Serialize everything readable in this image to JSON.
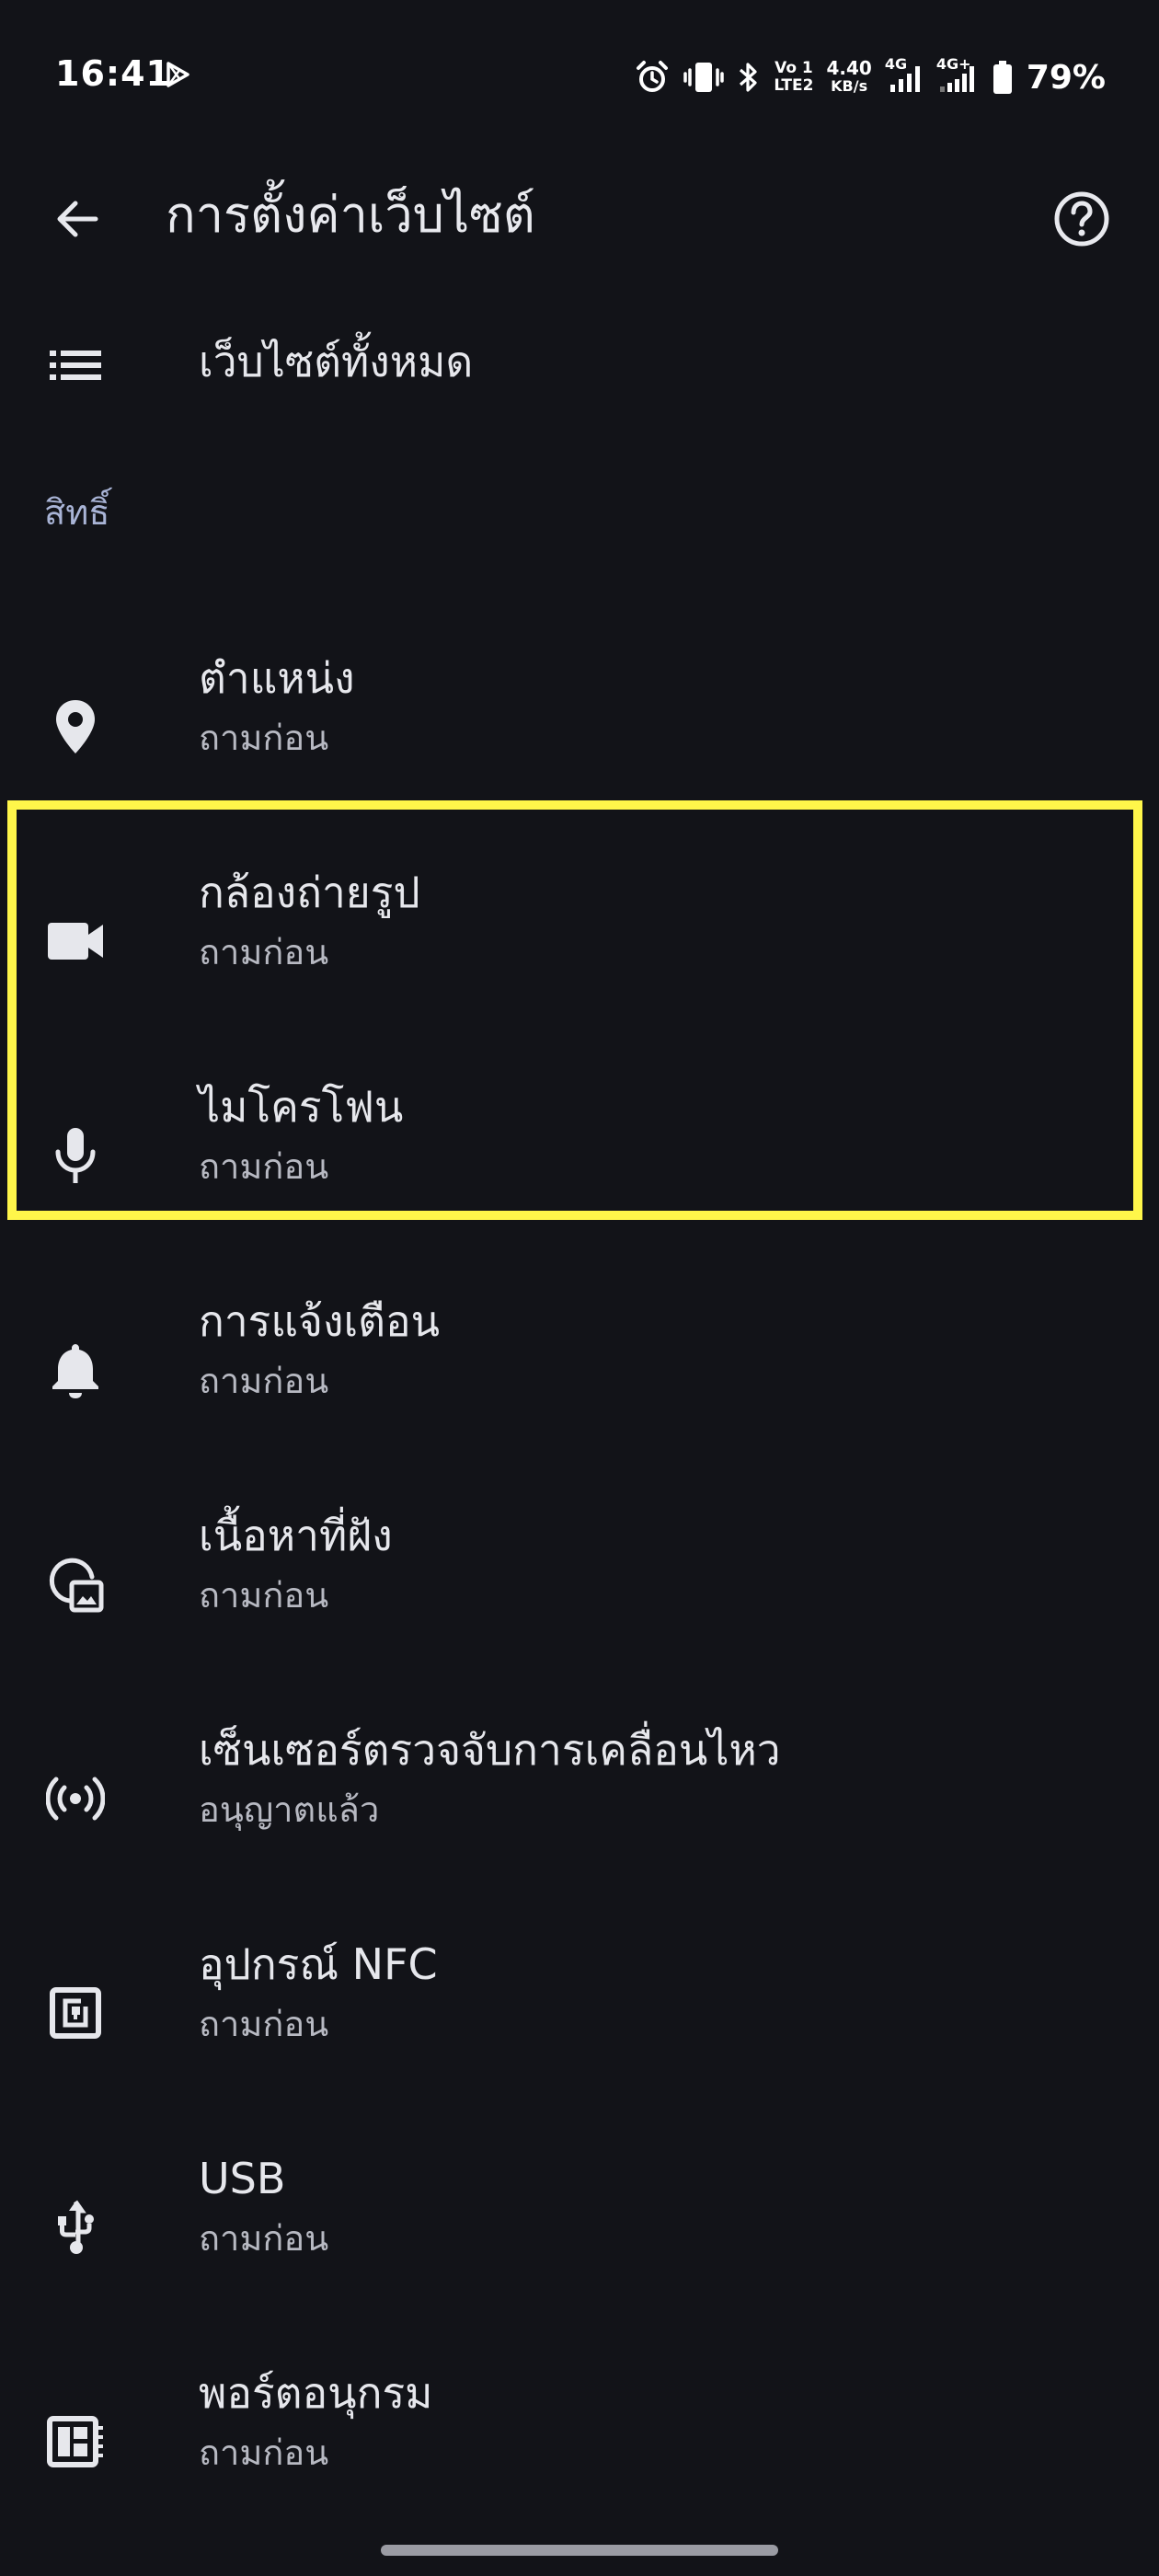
{
  "status_bar": {
    "time": "16:41",
    "volte_line1": "Vo 1",
    "volte_line2": "LTE2",
    "speed_value": "4.40",
    "speed_unit": "KB/s",
    "sim1_label": "4G",
    "sim2_label": "4G+",
    "battery_percent": "79%",
    "icons": [
      "play-store-icon",
      "alarm-icon",
      "vibrate-icon",
      "bluetooth-icon",
      "signal-icon",
      "battery-icon"
    ]
  },
  "app_bar": {
    "title": "การตั้งค่าเว็บไซต์",
    "back_icon": "arrow-back-icon",
    "help_icon": "help-circle-icon"
  },
  "all_sites": {
    "label": "เว็บไซต์ทั้งหมด",
    "icon": "list-icon"
  },
  "permissions": {
    "section_label": "สิทธิ์",
    "items": [
      {
        "title": "ตำแหน่ง",
        "status": "ถามก่อน",
        "icon": "location-pin-icon"
      },
      {
        "title": "กล้องถ่ายรูป",
        "status": "ถามก่อน",
        "icon": "videocam-icon"
      },
      {
        "title": "ไมโครโฟน",
        "status": "ถามก่อน",
        "icon": "microphone-icon"
      },
      {
        "title": "การแจ้งเตือน",
        "status": "ถามก่อน",
        "icon": "bell-icon"
      },
      {
        "title": "เนื้อหาที่ฝัง",
        "status": "ถามก่อน",
        "icon": "embedded-content-icon"
      },
      {
        "title": "เซ็นเซอร์ตรวจจับการเคลื่อนไหว",
        "status": "อนุญาตแล้ว",
        "icon": "motion-sensor-icon"
      },
      {
        "title": "อุปกรณ์ NFC",
        "status": "ถามก่อน",
        "icon": "nfc-icon"
      },
      {
        "title": "USB",
        "status": "ถามก่อน",
        "icon": "usb-icon"
      },
      {
        "title": "พอร์ตอนุกรม",
        "status": "ถามก่อน",
        "icon": "serial-port-icon"
      }
    ]
  },
  "colors": {
    "background": "#121318",
    "text_primary": "#e6e7ec",
    "text_secondary": "#b7b9c2",
    "section_header": "#a9b4d6",
    "highlight": "#fff64a"
  }
}
